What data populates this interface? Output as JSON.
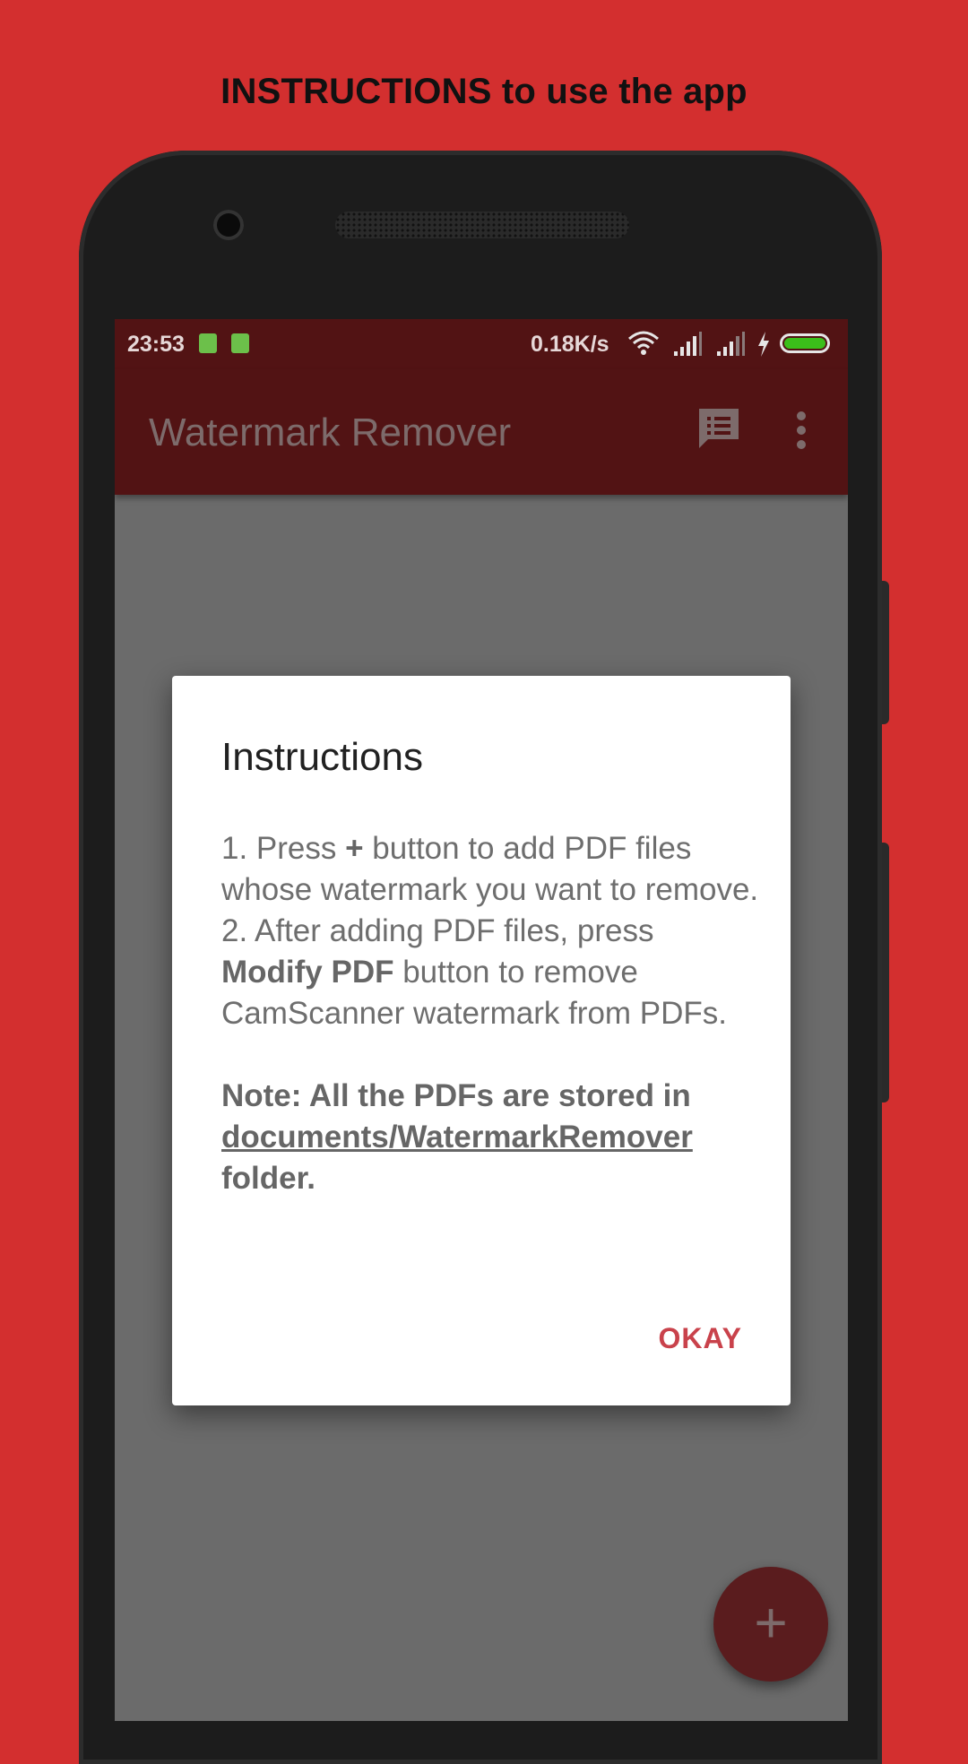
{
  "banner": {
    "text": "INSTRUCTIONS to use the app"
  },
  "statusbar": {
    "time": "23:53",
    "speed": "0.18K/s",
    "icons": [
      "android-notification-icon",
      "android-notification-icon",
      "wifi-icon",
      "signal-icon",
      "signal-icon",
      "charging-bolt-icon",
      "battery-icon"
    ]
  },
  "appbar": {
    "title": "Watermark Remover",
    "actions": [
      "feedback-icon",
      "more-vert-icon"
    ]
  },
  "dialog": {
    "title": "Instructions",
    "step1_prefix": "1. Press ",
    "step1_plus": "+",
    "step1_suffix": " button to add PDF files whose watermark you want to remove.",
    "step2_prefix": "2. After adding PDF files, press ",
    "step2_bold": "Modify PDF",
    "step2_suffix": " button to remove CamScanner watermark from PDFs.",
    "note_prefix": "Note: All the PDFs are stored in ",
    "note_path": "documents/WatermarkRemover",
    "note_suffix": " folder.",
    "okay_label": "OKAY"
  },
  "fab": {
    "label": "+"
  },
  "colors": {
    "background": "#d32f2f",
    "appbar": "#521314",
    "accent": "#c9424b",
    "battery": "#3bbf1a"
  }
}
